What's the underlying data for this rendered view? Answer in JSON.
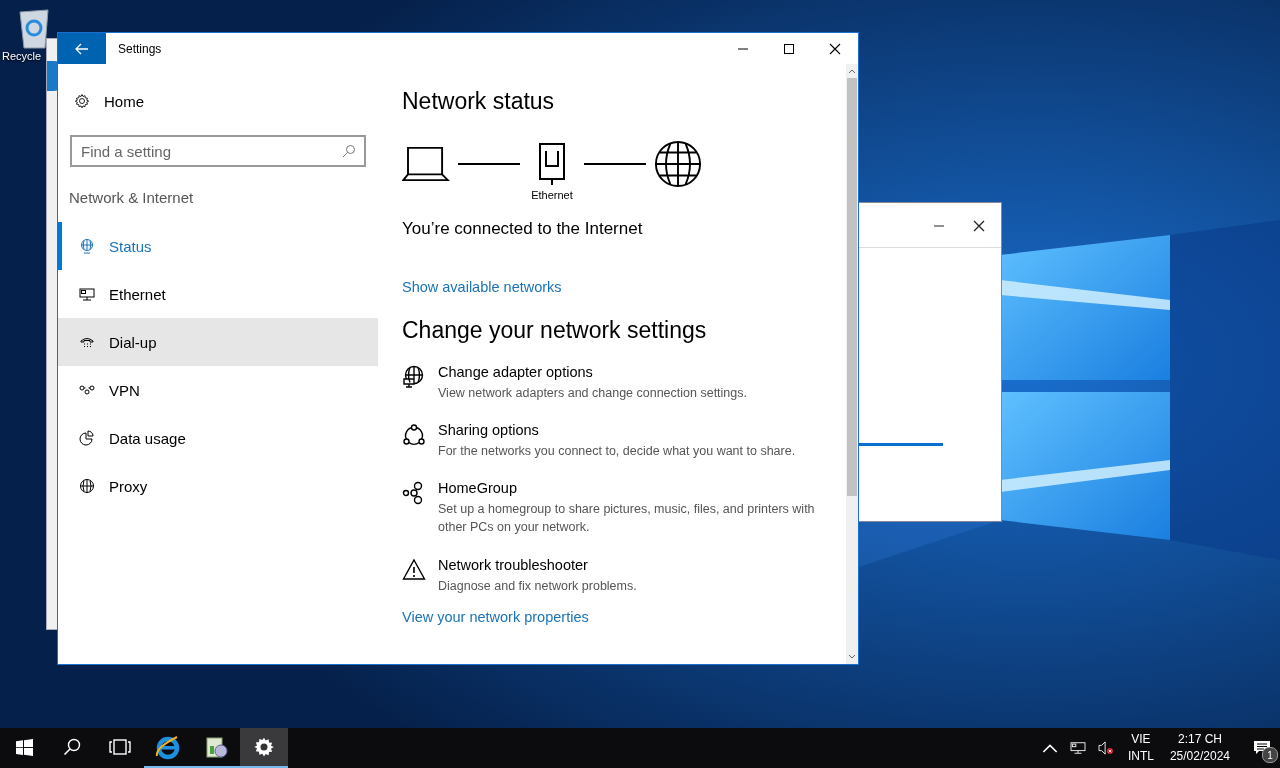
{
  "desktop": {
    "icons": [
      {
        "label": "Recycle"
      }
    ]
  },
  "settings_window": {
    "title": "Settings",
    "home": "Home",
    "search": {
      "placeholder": "Find a setting"
    },
    "section": "Network & Internet",
    "nav": [
      {
        "label": "Status",
        "selected": true,
        "hovered": false
      },
      {
        "label": "Ethernet",
        "selected": false,
        "hovered": false
      },
      {
        "label": "Dial-up",
        "selected": false,
        "hovered": true
      },
      {
        "label": "VPN",
        "selected": false,
        "hovered": false
      },
      {
        "label": "Data usage",
        "selected": false,
        "hovered": false
      },
      {
        "label": "Proxy",
        "selected": false,
        "hovered": false
      }
    ],
    "content": {
      "heading": "Network status",
      "connection_label": "Ethernet",
      "status": "You’re connected to the Internet",
      "link": "Show available networks",
      "heading2": "Change your network settings",
      "options": [
        {
          "title": "Change adapter options",
          "description": "View network adapters and change connection settings."
        },
        {
          "title": "Sharing options",
          "description": "For the networks you connect to, decide what you want to share."
        },
        {
          "title": "HomeGroup",
          "description": "Set up a homegroup to share pictures, music, files, and printers with other PCs on your network."
        },
        {
          "title": "Network troubleshooter",
          "description": "Diagnose and fix network problems."
        }
      ],
      "bottom_link": "View your network properties"
    }
  },
  "taskbar": {
    "apps": [
      {
        "active": false,
        "running": false
      },
      {
        "active": false,
        "running": false
      },
      {
        "active": false,
        "running": false
      },
      {
        "active": false,
        "running": true
      },
      {
        "active": false,
        "running": true
      },
      {
        "active": true,
        "running": true
      }
    ],
    "tray": {
      "language": "VIE",
      "layout": "INTL",
      "time": "2:17 CH",
      "date": "25/02/2024",
      "notifications": "1"
    }
  }
}
